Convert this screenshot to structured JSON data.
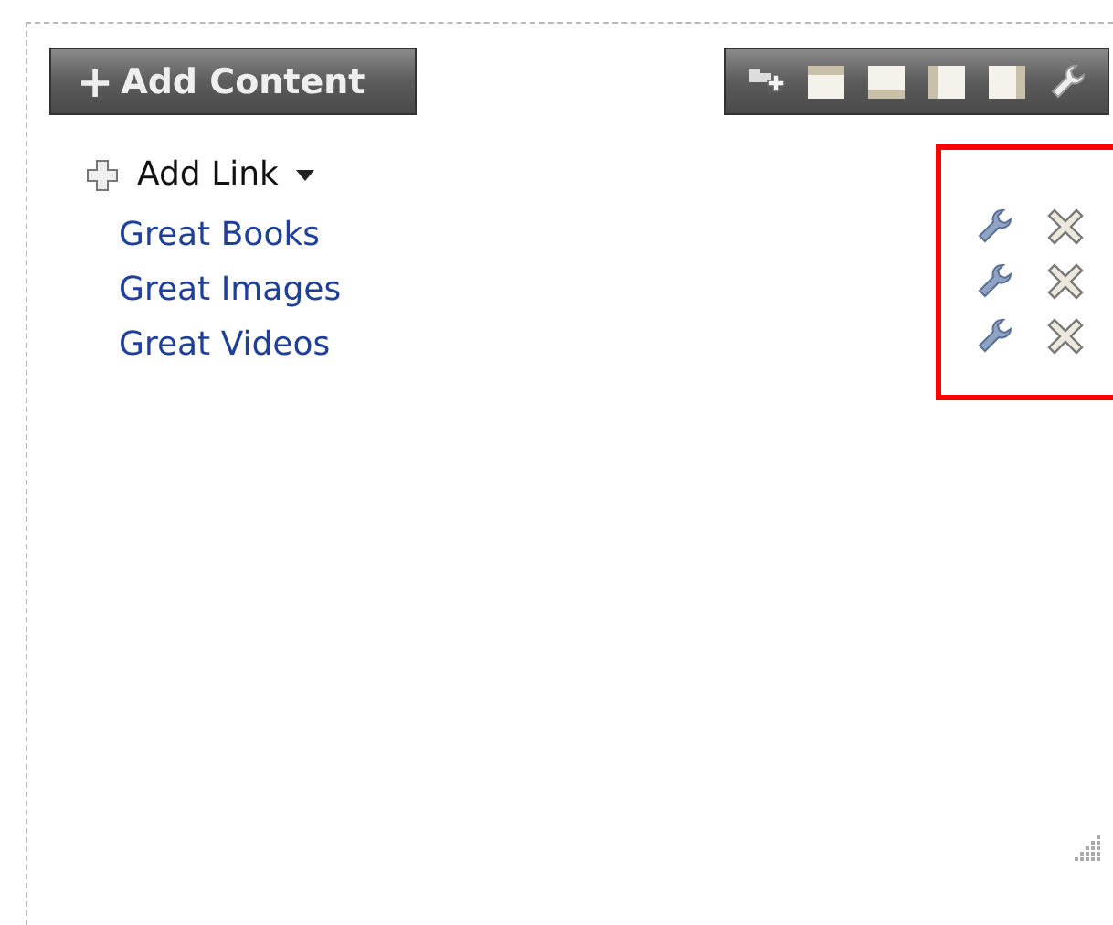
{
  "add_content_button": {
    "icon": "+",
    "label": "Add Content"
  },
  "add_link": {
    "label": "Add Link"
  },
  "links": [
    {
      "label": "Great Books"
    },
    {
      "label": "Great Images"
    },
    {
      "label": "Great Videos"
    }
  ]
}
